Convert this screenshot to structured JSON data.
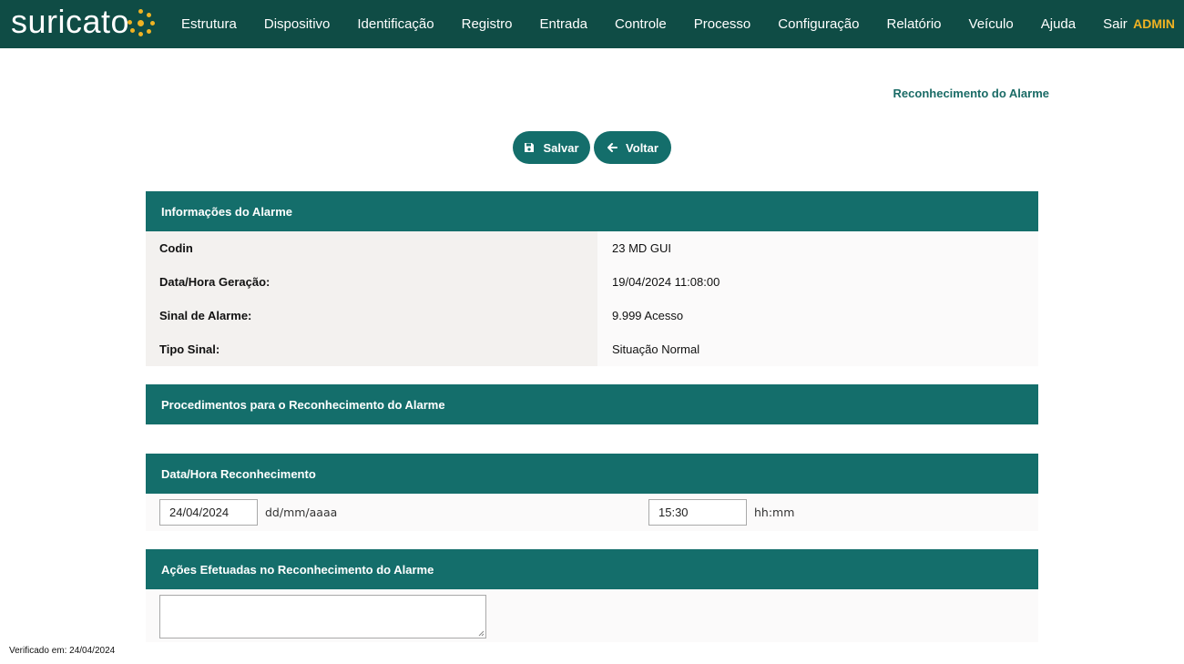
{
  "logo": {
    "text": "suricato"
  },
  "nav": {
    "items": [
      "Estrutura",
      "Dispositivo",
      "Identificação",
      "Registro",
      "Entrada",
      "Controle",
      "Processo",
      "Configuração",
      "Relatório",
      "Veículo",
      "Ajuda",
      "Sair"
    ],
    "user": "ADMIN"
  },
  "page": {
    "title": "Reconhecimento do Alarme"
  },
  "toolbar": {
    "save_label": "Salvar",
    "back_label": "Voltar"
  },
  "info": {
    "header": "Informações do Alarme",
    "rows": [
      {
        "label": "Codin",
        "value": "23 MD GUI"
      },
      {
        "label": "Data/Hora Geração:",
        "value": "19/04/2024 11:08:00"
      },
      {
        "label": "Sinal de Alarme:",
        "value": "9.999 Acesso"
      },
      {
        "label": "Tipo Sinal:",
        "value": "Situação Normal"
      }
    ]
  },
  "procedures": {
    "header": "Procedimentos para o Reconhecimento do Alarme"
  },
  "ack": {
    "header": "Data/Hora Reconhecimento",
    "date_value": "24/04/2024",
    "date_hint": "dd/mm/aaaa",
    "time_value": "15:30",
    "time_hint": "hh:mm"
  },
  "actions": {
    "header": "Ações Efetuadas no Reconhecimento do Alarme",
    "text": ""
  },
  "footer": {
    "verified": "Verificado em: 24/04/2024"
  },
  "colors": {
    "topbar": "#0f4c45",
    "accent": "#146e6b",
    "admin": "#f0b323"
  }
}
